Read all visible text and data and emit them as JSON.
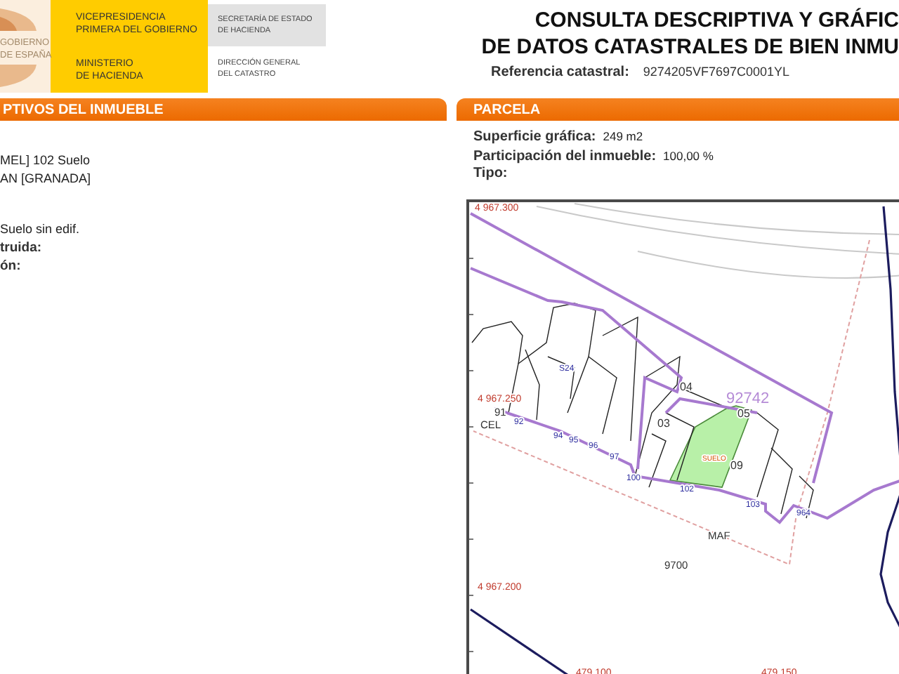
{
  "header": {
    "government": [
      "GOBIERNO",
      "DE ESPAÑA"
    ],
    "vicepresidency": [
      "VICEPRESIDENCIA",
      "PRIMERA DEL GOBIERNO"
    ],
    "ministry": [
      "MINISTERIO",
      "DE HACIENDA"
    ],
    "secretariat": [
      "SECRETARÍA DE ESTADO",
      "DE HACIENDA"
    ],
    "directorate": [
      "DIRECCIÓN GENERAL",
      "DEL CATASTRO"
    ]
  },
  "title": [
    "CONSULTA DESCRIPTIVA Y GRÁFIC",
    "DE DATOS CATASTRALES DE BIEN INMU"
  ],
  "reference": {
    "label": "Referencia catastral:",
    "value": "9274205VF7697C0001YL"
  },
  "property_panel": {
    "heading": "PTIVOS DEL INMUEBLE",
    "groups": [
      {
        "lines": [
          {
            "kind": "value",
            "text": "MEL] 102 Suelo"
          },
          {
            "kind": "value",
            "text": "AN [GRANADA]"
          }
        ]
      },
      {
        "lines": [
          {
            "kind": "value",
            "text": "Suelo sin edif."
          },
          {
            "kind": "label",
            "text": "truida:"
          },
          {
            "kind": "label",
            "text": "ón:"
          }
        ]
      }
    ]
  },
  "parcel_panel": {
    "heading": "PARCELA",
    "fields": [
      {
        "label": "Superficie gráfica:",
        "value": "249 m2"
      },
      {
        "label": "Participación del inmueble:",
        "value": "100,00 %"
      },
      {
        "label": "Tipo:"
      }
    ]
  },
  "map": {
    "labels": [
      {
        "kind": "coordinate",
        "text": "4 967.300"
      },
      {
        "kind": "coordinate",
        "text": "4 967.250"
      },
      {
        "kind": "parcel",
        "text": "92742"
      },
      {
        "kind": "subparcel",
        "text": "04"
      },
      {
        "kind": "subparcel",
        "text": "05"
      },
      {
        "kind": "subparcel",
        "text": "03"
      },
      {
        "kind": "subparcel",
        "text": "09"
      },
      {
        "kind": "use",
        "text": "SUELO"
      },
      {
        "kind": "number",
        "text": "102"
      },
      {
        "kind": "number",
        "text": "100"
      },
      {
        "kind": "number",
        "text": "S24"
      },
      {
        "kind": "block",
        "text": "91"
      },
      {
        "kind": "block",
        "text": "CEL"
      },
      {
        "kind": "number",
        "text": "92"
      },
      {
        "kind": "number",
        "text": "94"
      },
      {
        "kind": "number",
        "text": "95"
      },
      {
        "kind": "number",
        "text": "96"
      },
      {
        "kind": "number",
        "text": "97"
      },
      {
        "kind": "number",
        "text": "103"
      },
      {
        "kind": "number",
        "text": "964"
      },
      {
        "kind": "block",
        "text": "MAF"
      },
      {
        "kind": "block",
        "text": "9700"
      },
      {
        "kind": "coordinate",
        "text": "4 967.200"
      },
      {
        "kind": "coordinate",
        "text": "479.100"
      },
      {
        "kind": "coordinate",
        "text": "479.150"
      }
    ]
  }
}
